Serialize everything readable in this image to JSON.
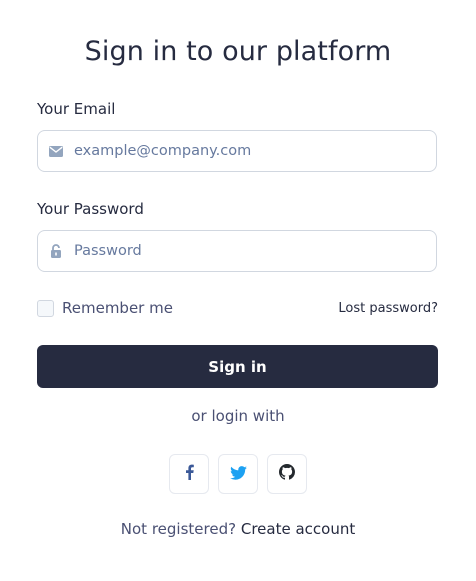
{
  "title": "Sign in to our platform",
  "email": {
    "label": "Your Email",
    "placeholder": "example@company.com",
    "icon": "envelope-icon"
  },
  "password": {
    "label": "Your Password",
    "placeholder": "Password",
    "icon": "lock-icon"
  },
  "remember": {
    "label": "Remember me",
    "checked": false
  },
  "lost_password": "Lost password?",
  "submit_label": "Sign in",
  "alt_login_text": "or login with",
  "social_buttons": [
    {
      "name": "facebook",
      "icon": "facebook-icon",
      "color": "#3b5998"
    },
    {
      "name": "twitter",
      "icon": "twitter-icon",
      "color": "#1da1f2"
    },
    {
      "name": "github",
      "icon": "github-icon",
      "color": "#24292e"
    }
  ],
  "register": {
    "prompt": "Not registered?",
    "link": "Create account"
  },
  "colors": {
    "primary": "#262b40",
    "border": "#d1d7e0",
    "muted_text": "#4a5073",
    "icon_gray": "#93a5be"
  }
}
